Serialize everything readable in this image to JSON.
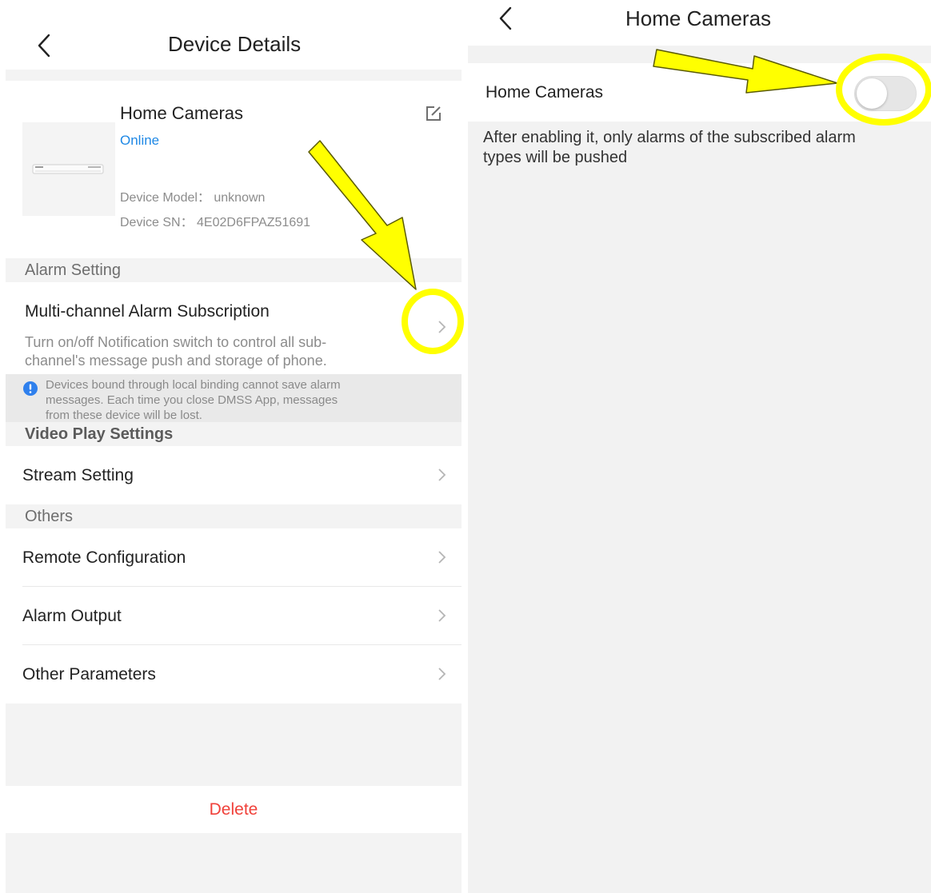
{
  "left": {
    "nav_title": "Device Details",
    "device": {
      "name": "Home Cameras",
      "status": "Online",
      "model_text": "Device Model： unknown",
      "sn_text": "Device SN： 4E02D6FPAZ51691"
    },
    "sections": {
      "alarm_setting": "Alarm Setting",
      "video_play": "Video Play Settings",
      "others": "Others"
    },
    "alarm_subscription": {
      "title": "Multi-channel Alarm Subscription",
      "desc_line1": "Turn on/off Notification switch to control all sub-",
      "desc_line2": "channel's message push and storage of phone."
    },
    "info_notice": {
      "line1": "Devices bound through local binding cannot save alarm",
      "line2": "messages. Each time you close DMSS App, messages",
      "line3": "from these device will be lost."
    },
    "rows": {
      "stream_setting": "Stream Setting",
      "remote_configuration": "Remote Configuration",
      "alarm_output": "Alarm Output",
      "other_parameters": "Other Parameters"
    },
    "delete_label": "Delete"
  },
  "right": {
    "nav_title": "Home Cameras",
    "toggle_label": "Home Cameras",
    "toggle_on": false,
    "desc_line1": "After enabling it, only alarms of the subscribed alarm",
    "desc_line2": "types will be pushed"
  },
  "colors": {
    "online": "#1e88e5",
    "delete": "#f0413a",
    "highlight": "#ffff00",
    "info_icon": "#2f80ed"
  },
  "icons": [
    "back-arrow-icon",
    "edit-icon",
    "chevron-right-icon",
    "info-icon",
    "dvr-device-icon"
  ]
}
